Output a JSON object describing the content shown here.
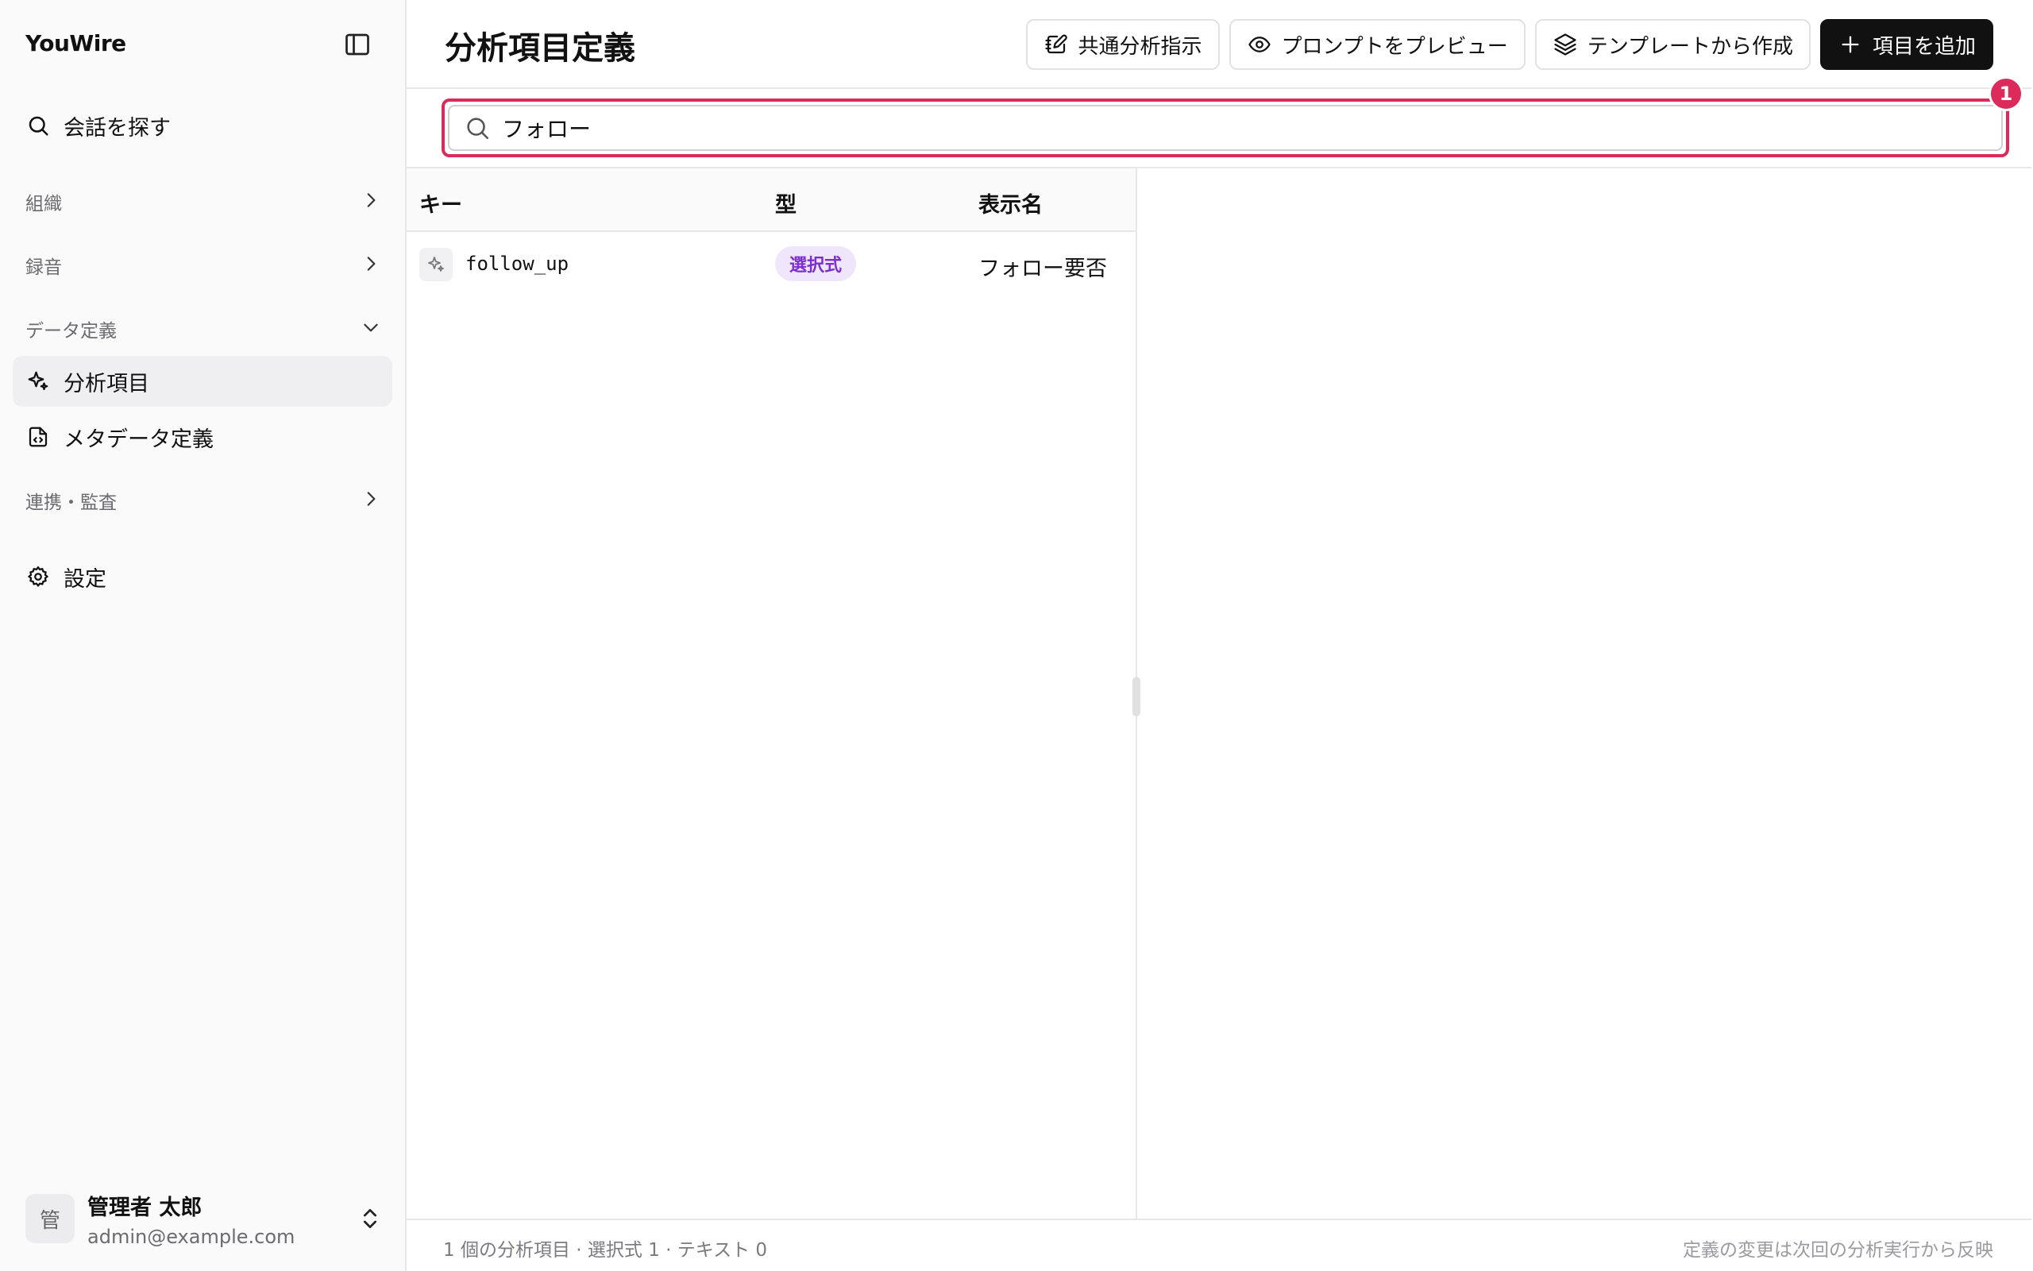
{
  "app": {
    "name": "YouWire"
  },
  "sidebar": {
    "search_label": "会話を探す",
    "groups": {
      "organization": "組織",
      "recording": "録音",
      "data_definition": "データ定義",
      "integration": "連携・監査"
    },
    "items": {
      "analysis_items": "分析項目",
      "metadata_definition": "メタデータ定義",
      "settings": "設定"
    },
    "user": {
      "avatar_initial": "管",
      "name": "管理者 太郎",
      "email": "admin@example.com"
    }
  },
  "header": {
    "title": "分析項目定義",
    "buttons": {
      "common_instruction": "共通分析指示",
      "preview_prompt": "プロンプトをプレビュー",
      "from_template": "テンプレートから作成",
      "add_item": "項目を追加"
    }
  },
  "search": {
    "value": "フォロー",
    "step_marker": "1"
  },
  "table": {
    "columns": {
      "key": "キー",
      "type": "型",
      "display_name": "表示名"
    },
    "rows": [
      {
        "key": "follow_up",
        "type": "選択式",
        "display_name": "フォロー要否"
      }
    ]
  },
  "footer": {
    "summary": "1 個の分析項目 · 選択式 1 · テキスト 0",
    "note": "定義の変更は次回の分析実行から反映"
  },
  "colors": {
    "accent_highlight": "#dc2b5a",
    "primary_button": "#111111",
    "type_badge_bg": "#f0e6fb",
    "type_badge_text": "#7b2fcf"
  }
}
